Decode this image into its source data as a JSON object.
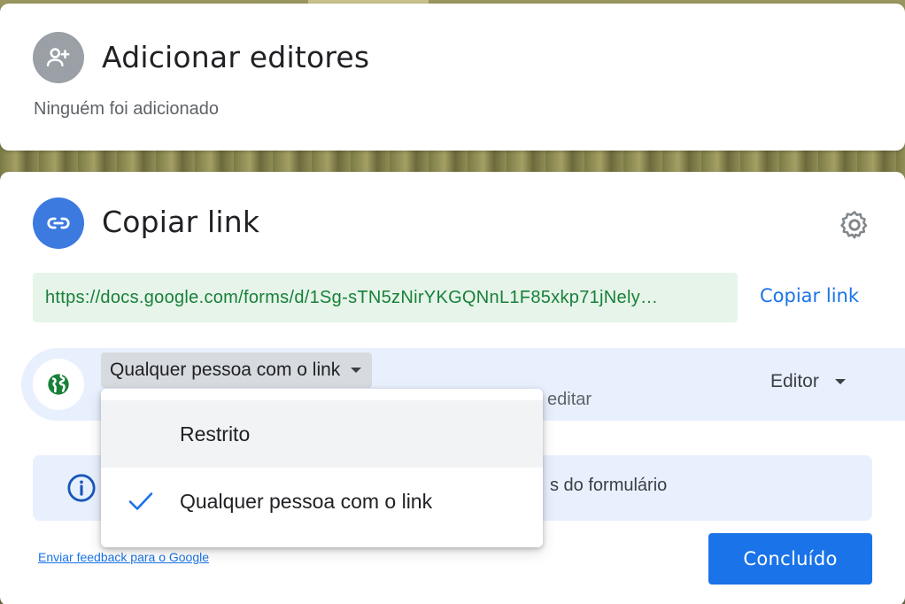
{
  "editors": {
    "title": "Adicionar editores",
    "status": "Ninguém foi adicionado",
    "icon": "person-add-icon"
  },
  "link": {
    "title": "Copiar link",
    "url": "https://docs.google.com/forms/d/1Sg-sTN5zNirYKGQNnL1F85xkp71jNely…",
    "copy_label": "Copiar link",
    "access_selected": "Qualquer pessoa com o link",
    "access_description": "editar",
    "role_selected": "Editor"
  },
  "info": {
    "text": "s do formulário"
  },
  "footer": {
    "feedback_label": "Enviar feedback para o Google",
    "done_label": "Concluído"
  },
  "dropdown": {
    "options": [
      {
        "label": "Restrito",
        "selected": false
      },
      {
        "label": "Qualquer pessoa com o link",
        "selected": true
      }
    ]
  },
  "colors": {
    "accent": "#1a73e8",
    "url_bg": "#e6f4ea",
    "url_text": "#188038",
    "globe": "#188038"
  }
}
